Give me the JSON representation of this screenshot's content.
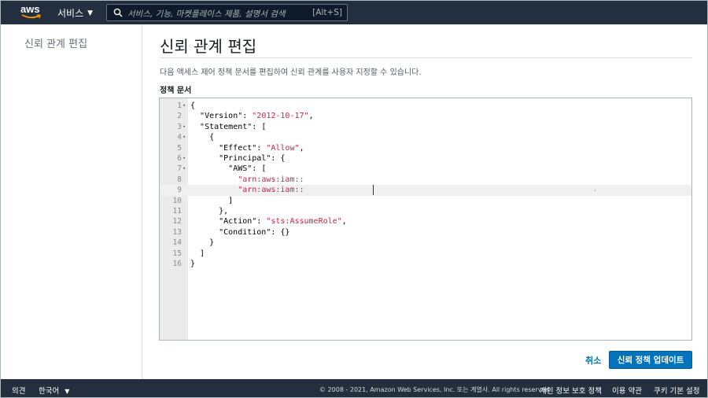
{
  "topnav": {
    "logo_text": "aws",
    "services_label": "서비스",
    "search_placeholder": "서비스, 기능, 마켓플레이스 제품, 설명서 검색",
    "search_shortcut": "[Alt+S]"
  },
  "leftnav": {
    "title": "신뢰 관계 편집"
  },
  "main": {
    "title": "신뢰 관계 편집",
    "description": "다음 액세스 제어 정책 문서를 편집하여 신뢰 관계를 사용자 지정할 수 있습니다.",
    "editor_label": "정책 문서",
    "lines": [
      {
        "num": "1",
        "fold": "▾",
        "indent": "",
        "parts": [
          {
            "t": "{"
          }
        ]
      },
      {
        "num": "2",
        "fold": "",
        "indent": "  ",
        "parts": [
          {
            "t": "\"Version\": "
          },
          {
            "t": "\"2012-10-17\"",
            "s": true
          },
          {
            "t": ","
          }
        ]
      },
      {
        "num": "3",
        "fold": "▾",
        "indent": "  ",
        "parts": [
          {
            "t": "\"Statement\": ["
          }
        ]
      },
      {
        "num": "4",
        "fold": "▾",
        "indent": "    ",
        "parts": [
          {
            "t": "{"
          }
        ]
      },
      {
        "num": "5",
        "fold": "",
        "indent": "      ",
        "parts": [
          {
            "t": "\"Effect\": "
          },
          {
            "t": "\"Allow\"",
            "s": true
          },
          {
            "t": ","
          }
        ]
      },
      {
        "num": "6",
        "fold": "▾",
        "indent": "      ",
        "parts": [
          {
            "t": "\"Principal\": {"
          }
        ]
      },
      {
        "num": "7",
        "fold": "▾",
        "indent": "        ",
        "parts": [
          {
            "t": "\"AWS\": ["
          }
        ]
      },
      {
        "num": "8",
        "fold": "",
        "indent": "          ",
        "parts": [
          {
            "t": "\"arn:aws:iam::",
            "s": true
          }
        ]
      },
      {
        "num": "9",
        "fold": "",
        "indent": "          ",
        "parts": [
          {
            "t": "\"arn:aws:iam::",
            "s": true
          }
        ]
      },
      {
        "num": "10",
        "fold": "",
        "indent": "        ",
        "parts": [
          {
            "t": "]"
          }
        ]
      },
      {
        "num": "11",
        "fold": "",
        "indent": "      ",
        "parts": [
          {
            "t": "},"
          }
        ]
      },
      {
        "num": "12",
        "fold": "",
        "indent": "      ",
        "parts": [
          {
            "t": "\"Action\": "
          },
          {
            "t": "\"sts:AssumeRole\"",
            "s": true
          },
          {
            "t": ","
          }
        ]
      },
      {
        "num": "13",
        "fold": "",
        "indent": "      ",
        "parts": [
          {
            "t": "\"Condition\": {}"
          }
        ]
      },
      {
        "num": "14",
        "fold": "",
        "indent": "    ",
        "parts": [
          {
            "t": "}"
          }
        ]
      },
      {
        "num": "15",
        "fold": "",
        "indent": "  ",
        "parts": [
          {
            "t": "]"
          }
        ]
      },
      {
        "num": "16",
        "fold": "",
        "indent": "",
        "parts": [
          {
            "t": "}"
          }
        ]
      }
    ],
    "active_line": 9,
    "cancel_label": "취소",
    "submit_label": "신뢰 정책 업데이트"
  },
  "footer": {
    "feedback": "의견",
    "language": "한국어",
    "copyright": "© 2008 - 2021, Amazon Web Services, Inc. 또는 계열사. All rights reserved.",
    "privacy": "개인 정보 보호 정책",
    "terms": "이용 약관",
    "cookies": "쿠키 기본 설정"
  },
  "colors": {
    "nav_bg": "#232f3e",
    "primary": "#0073bb",
    "string": "#c7254e"
  }
}
